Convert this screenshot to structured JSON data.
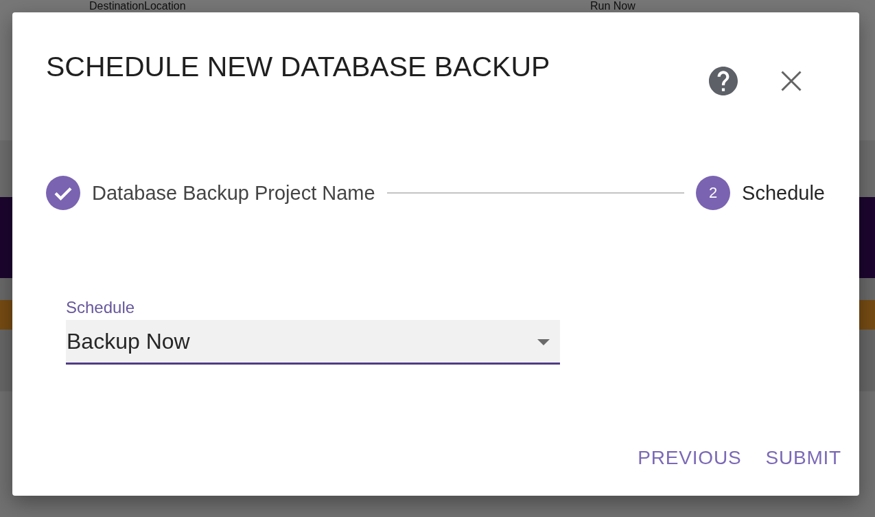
{
  "background_page": {
    "columns": [
      "DestinationLocation",
      "Run Now"
    ]
  },
  "dialog": {
    "title": "SCHEDULE NEW DATABASE BACKUP",
    "steps": [
      {
        "label": "Database Backup Project Name",
        "completed": true,
        "selected": false
      },
      {
        "number": "2",
        "label": "Schedule",
        "completed": false,
        "selected": true
      }
    ],
    "field": {
      "label": "Schedule",
      "value": "Backup Now",
      "focused": true
    },
    "buttons": [
      "PREVIOUS",
      "SUBMIT"
    ]
  }
}
